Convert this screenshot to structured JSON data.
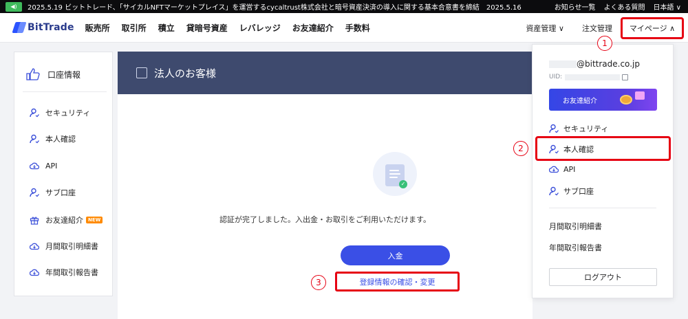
{
  "announcement": {
    "news": "2025.5.19 ビットトレード、「サイカルNFTマーケットプレイス」を運営するcycaltrust株式会社と暗号資産決済の導入に関する基本合意書を締結　2025.5.16 _",
    "links": [
      "お知らせ一覧",
      "よくある質問",
      "日本語 ∨"
    ]
  },
  "nav": {
    "logo": "BitTrade",
    "menu": [
      "販売所",
      "取引所",
      "積立",
      "貸暗号資産",
      "レバレッジ",
      "お友達紹介",
      "手数料"
    ],
    "asset": "資産管理 ∨",
    "order": "注文管理",
    "mypage": "マイページ ∧"
  },
  "sidebar": {
    "top": "口座情報",
    "items": [
      "セキュリティ",
      "本人確認",
      "API",
      "サブ口座",
      "お友達紹介",
      "月間取引明細書",
      "年間取引報告書"
    ],
    "new_badge": "NEW"
  },
  "main": {
    "title": "法人のお客様",
    "message": "認証が完了しました。入出金・お取引をご利用いただけます。",
    "deposit": "入金",
    "confirm": "登録情報の確認・変更"
  },
  "dropdown": {
    "email": "@bittrade.co.jp",
    "uid_label": "UID:",
    "banner": "お友達紹介",
    "items": [
      "セキュリティ",
      "本人確認",
      "API",
      "サブ口座"
    ],
    "lower": [
      "月間取引明細書",
      "年間取引報告書"
    ],
    "logout": "ログアウト"
  },
  "steps": [
    "1",
    "2",
    "3"
  ],
  "colors": {
    "accent": "#3a4fe6",
    "highlight": "#e60012",
    "header": "#3e4a6e"
  },
  "icons": {
    "user": "user-icon",
    "cloud": "cloud-icon",
    "gift": "gift-icon",
    "thumb": "thumbs-up-icon"
  }
}
